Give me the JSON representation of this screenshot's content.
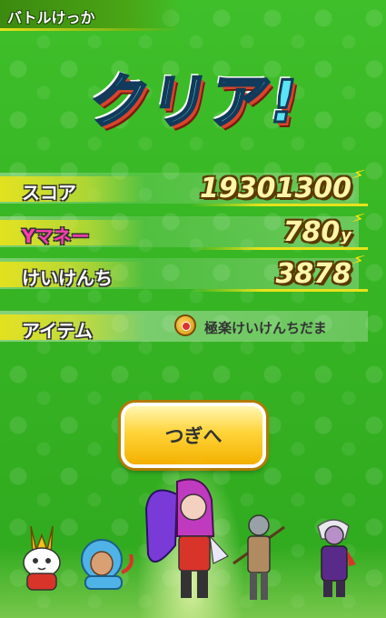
{
  "header": {
    "title": "バトルけっか"
  },
  "result": {
    "title": "クリア!"
  },
  "stats": [
    {
      "label": "スコア",
      "value": "19301300",
      "unit": ""
    },
    {
      "label": "Yマネー",
      "value": "780",
      "unit": "y"
    },
    {
      "label": "けいけんち",
      "value": "3878",
      "unit": ""
    }
  ],
  "item": {
    "label": "アイテム",
    "name": "極楽けいけんちだま",
    "icon": "experience-orb-icon"
  },
  "next_button": {
    "label": "つぎへ"
  },
  "colors": {
    "background": "#2fae1f",
    "accent_yellow": "#e8e21a",
    "button": "#ffd43a",
    "title_cyan": "#5be4f5"
  }
}
